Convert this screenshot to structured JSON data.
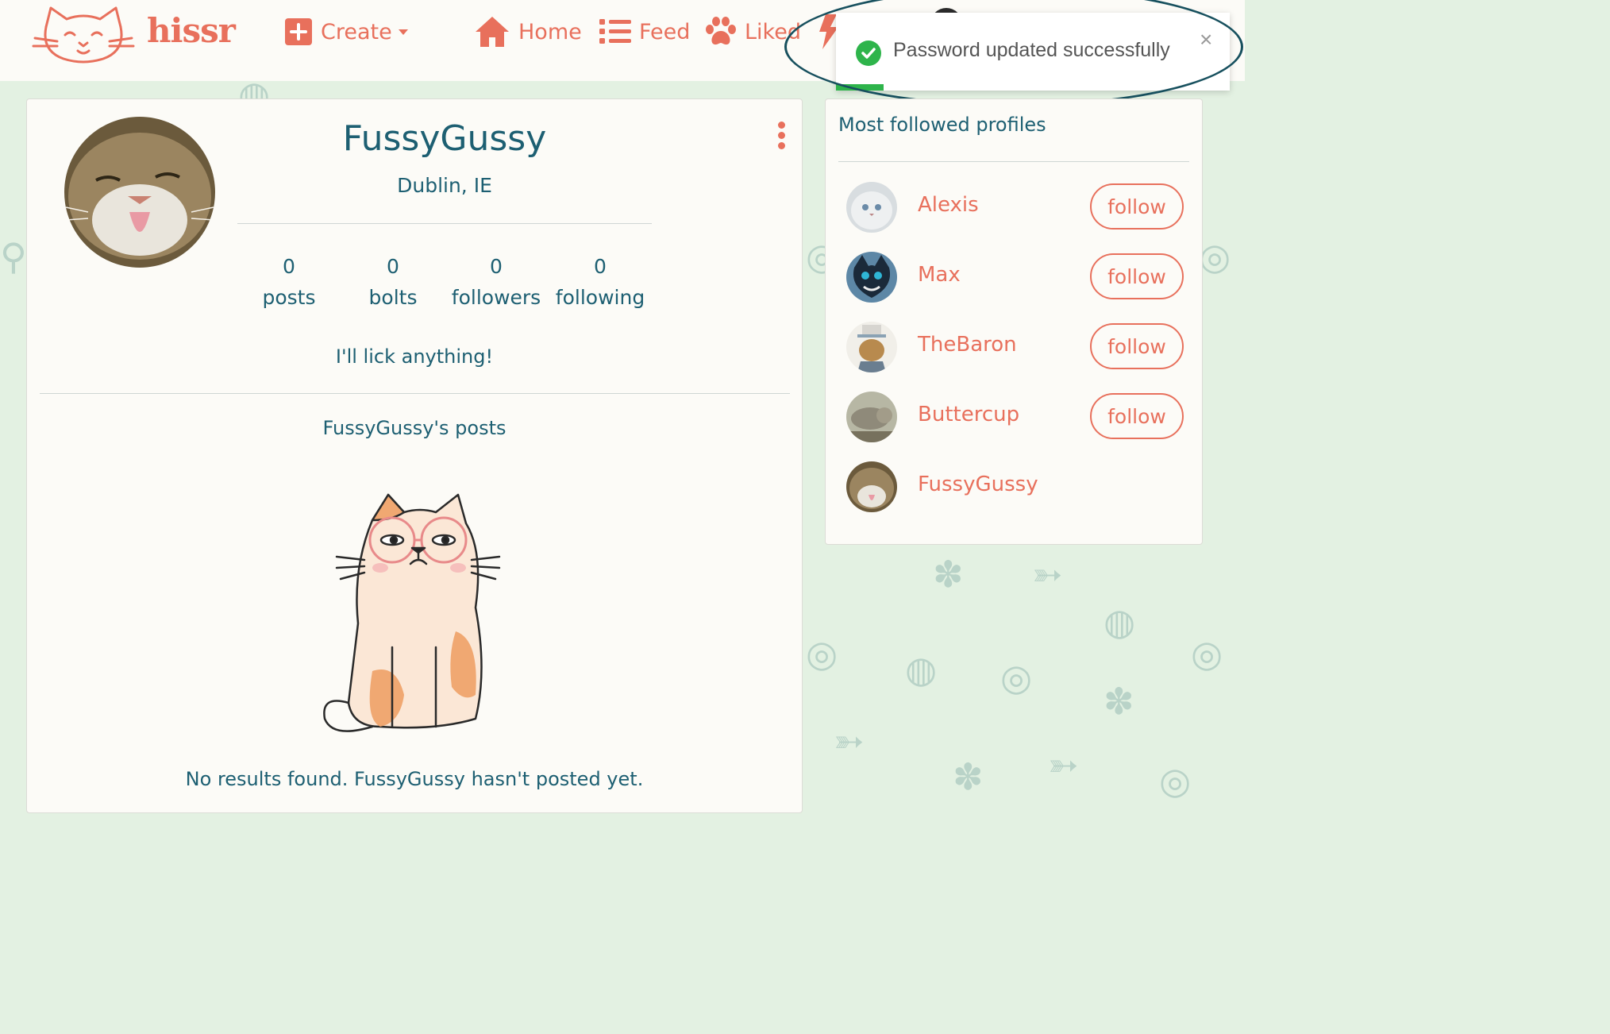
{
  "app": {
    "brand": "hissr",
    "colors": {
      "accent": "#e8705c",
      "text": "#1d5f72",
      "background": "#e3f1e2",
      "card": "#fcfbf7",
      "success": "#2eb44b"
    }
  },
  "nav": {
    "create_label": "Create",
    "home_label": "Home",
    "feed_label": "Feed",
    "liked_label": "Liked"
  },
  "toast": {
    "message": "Password updated successfully",
    "close_glyph": "×",
    "progress": 0.12
  },
  "profile": {
    "username": "FussyGussy",
    "location": "Dublin, IE",
    "stats": [
      {
        "value": "0",
        "label": "posts"
      },
      {
        "value": "0",
        "label": "bolts"
      },
      {
        "value": "0",
        "label": "followers"
      },
      {
        "value": "0",
        "label": "following"
      }
    ],
    "bio": "I'll lick anything!",
    "posts_title": "FussyGussy's posts",
    "no_results": "No results found. FussyGussy hasn't posted yet."
  },
  "sidebar": {
    "title": "Most followed profiles",
    "follow_label": "follow",
    "profiles": [
      {
        "name": "Alexis",
        "show_follow": true
      },
      {
        "name": "Max",
        "show_follow": true
      },
      {
        "name": "TheBaron",
        "show_follow": true
      },
      {
        "name": "Buttercup",
        "show_follow": true
      },
      {
        "name": "FussyGussy",
        "show_follow": false
      }
    ]
  }
}
